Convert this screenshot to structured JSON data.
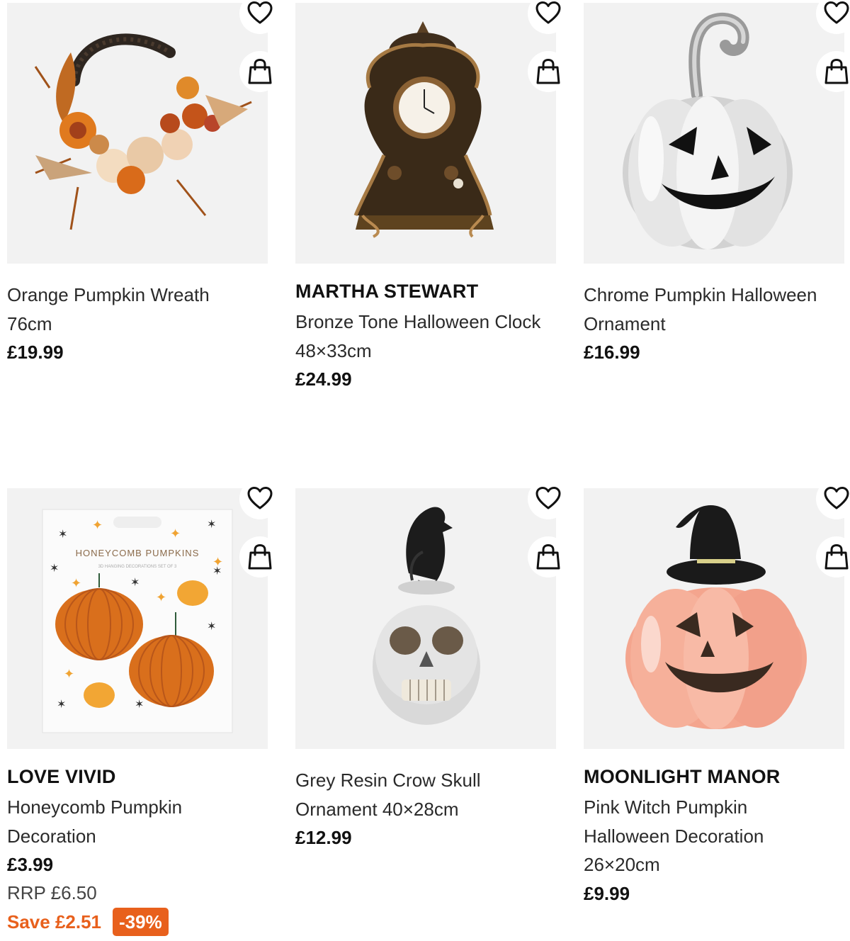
{
  "products": [
    {
      "brand": "",
      "name_line1": "Orange Pumpkin Wreath",
      "name_line2": "76cm",
      "price": "£19.99",
      "image": "orange-pumpkin-wreath-photo"
    },
    {
      "brand": "MARTHA STEWART",
      "name_line1": "Bronze Tone Halloween Clock",
      "name_line2": "48×33cm",
      "price": "£24.99",
      "image": "bronze-clock-photo"
    },
    {
      "brand": "",
      "name_line1": "Chrome Pumpkin Halloween",
      "name_line2": "Ornament",
      "price": "£16.99",
      "image": "chrome-pumpkin-photo"
    },
    {
      "brand": "LOVE VIVID",
      "name_line1": "Honeycomb Pumpkin",
      "name_line2": "Decoration",
      "price": "£3.99",
      "rrp": "RRP £6.50",
      "save": "Save £2.51",
      "discount": "-39%",
      "package_title": "HONEYCOMB PUMPKINS",
      "package_subtitle": "3D HANGING DECORATIONS SET OF 3",
      "image": "honeycomb-pumpkin-package-photo"
    },
    {
      "brand": "",
      "name_line1": "Grey Resin Crow Skull",
      "name_line2": "Ornament 40×28cm",
      "price": "£12.99",
      "image": "crow-skull-photo"
    },
    {
      "brand": "MOONLIGHT MANOR",
      "name_line1": "Pink Witch Pumpkin",
      "name_line2": "Halloween Decoration",
      "name_line3": "26×20cm",
      "price": "£9.99",
      "image": "pink-witch-pumpkin-photo"
    }
  ],
  "icons": {
    "wishlist": "heart-icon",
    "basket": "shopping-bag-icon"
  },
  "colors": {
    "save_accent": "#e8601c",
    "image_bg": "#f1f1f1",
    "text": "#222222"
  }
}
